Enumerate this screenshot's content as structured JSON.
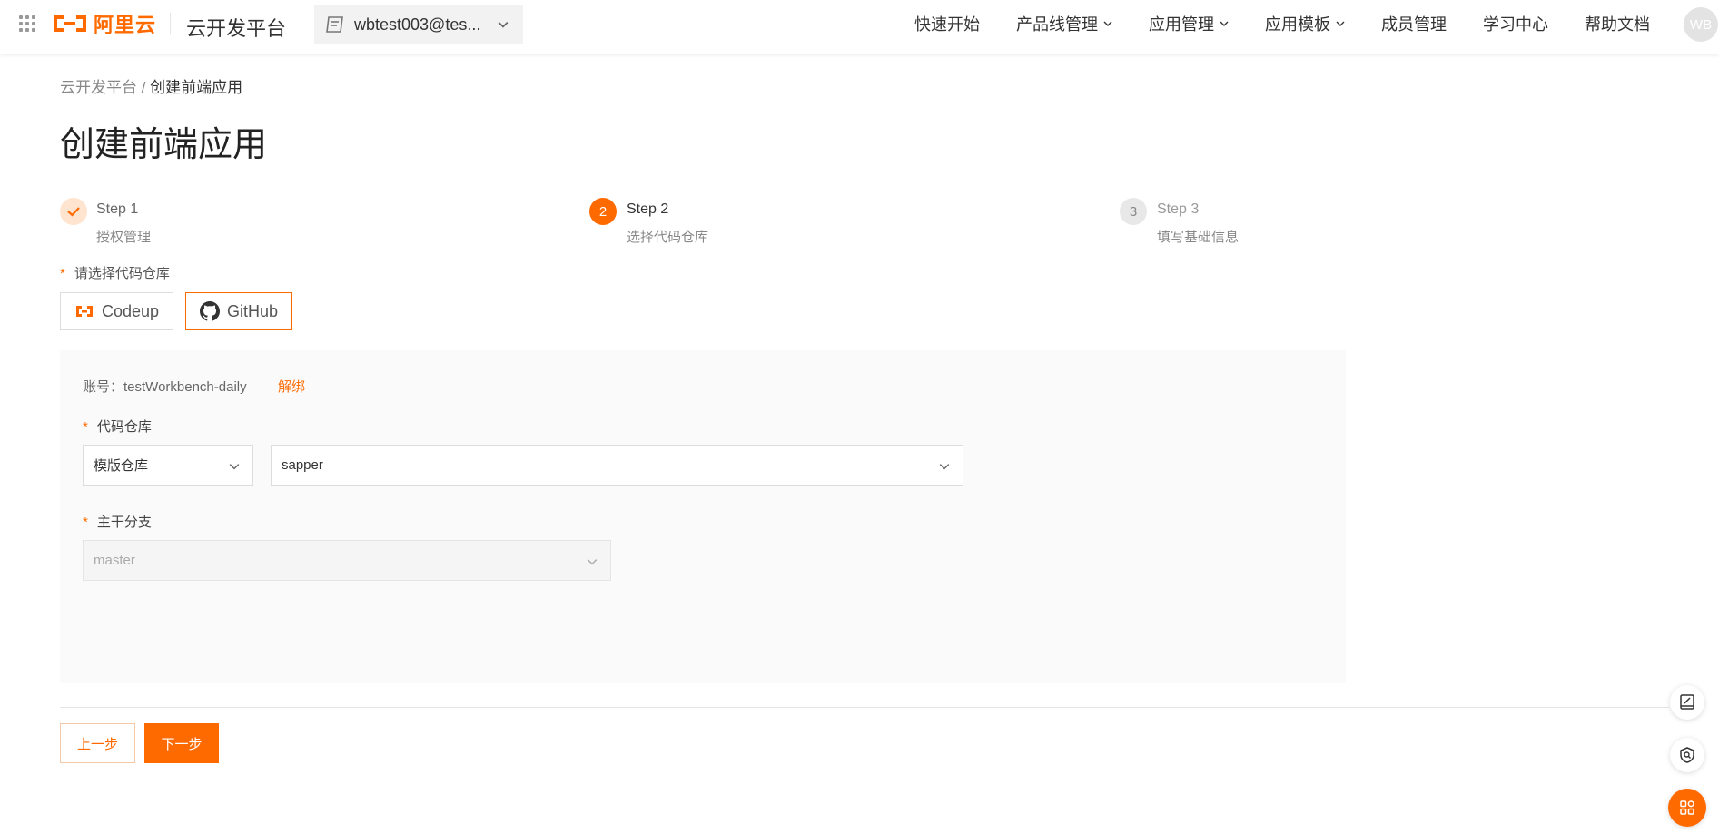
{
  "header": {
    "brand_name": "阿里云",
    "platform_title": "云开发平台",
    "account": "wbtest003@tes...",
    "nav": [
      "快速开始",
      "产品线管理",
      "应用管理",
      "应用模板",
      "成员管理",
      "学习中心",
      "帮助文档"
    ],
    "avatar_initials": "WB"
  },
  "breadcrumb": {
    "root": "云开发平台",
    "separator": " / ",
    "current": "创建前端应用"
  },
  "page_title": "创建前端应用",
  "steps": [
    {
      "title": "Step 1",
      "desc": "授权管理",
      "status": "done"
    },
    {
      "title": "Step 2",
      "desc": "选择代码仓库",
      "status": "current",
      "number": "2"
    },
    {
      "title": "Step 3",
      "desc": "填写基础信息",
      "status": "pending",
      "number": "3"
    }
  ],
  "repo_section": {
    "required_mark": "*",
    "label": "请选择代码仓库",
    "sources": [
      "Codeup",
      "GitHub"
    ],
    "active_source": "GitHub"
  },
  "panel": {
    "account_text": "账号：testWorkbench-daily",
    "unbind": "解绑",
    "repo_label": "代码仓库",
    "repo_type_value": "模版仓库",
    "repo_value": "sapper",
    "branch_label": "主干分支",
    "branch_placeholder": "master"
  },
  "footer": {
    "prev": "上一步",
    "next": "下一步"
  },
  "colors": {
    "accent": "#ff6a00"
  }
}
